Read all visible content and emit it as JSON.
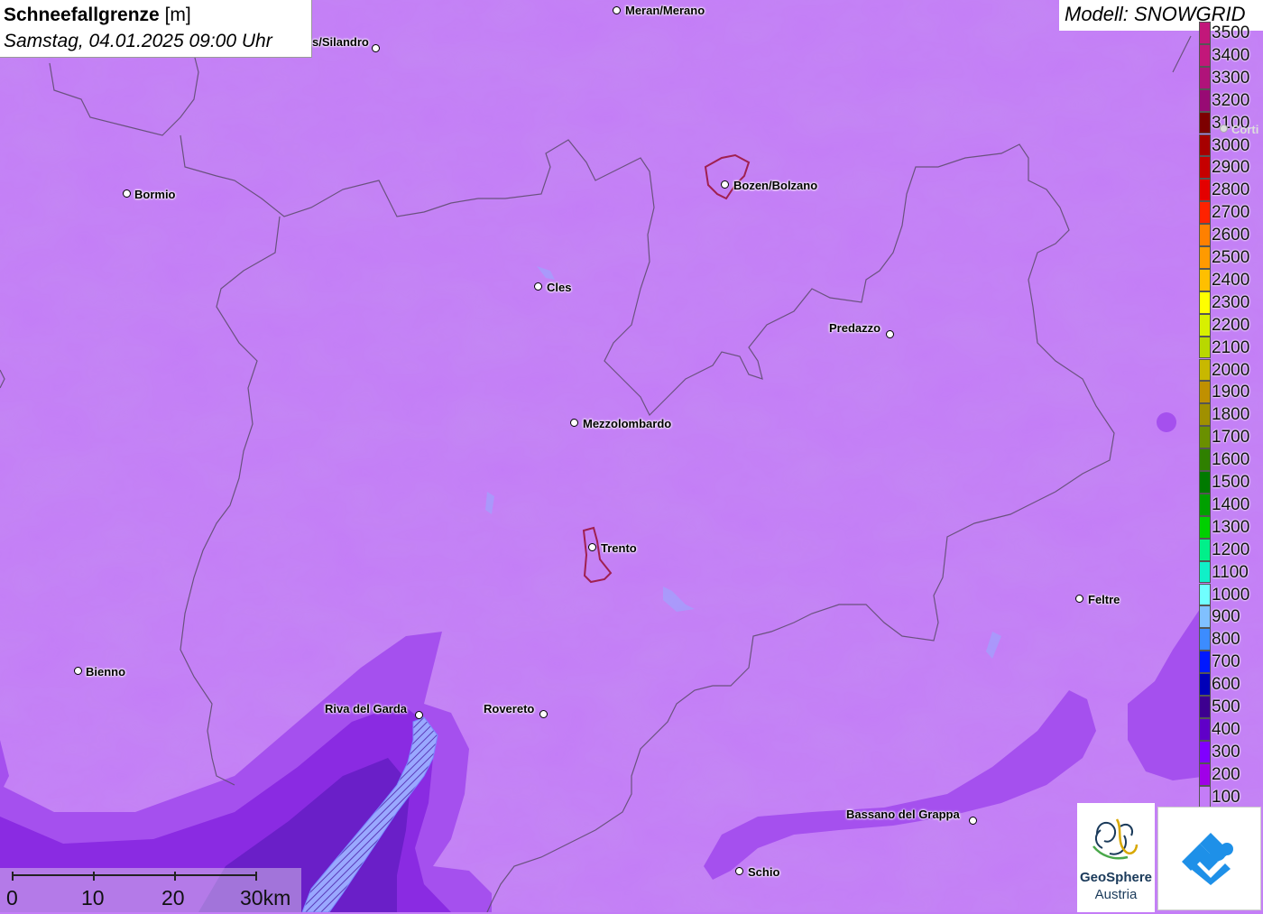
{
  "title": {
    "parameter": "Schneefallgrenze",
    "unit": "[m]",
    "datetime": "Samstag, 04.01.2025 09:00 Uhr"
  },
  "model_label": "Modell: SNOWGRID",
  "legend": {
    "items": [
      {
        "label": "3500",
        "color": "#c2177a"
      },
      {
        "label": "3400",
        "color": "#c2177a"
      },
      {
        "label": "3300",
        "color": "#b0137a"
      },
      {
        "label": "3200",
        "color": "#980a74"
      },
      {
        "label": "3100",
        "color": "#7d0000"
      },
      {
        "label": "3000",
        "color": "#a70000"
      },
      {
        "label": "2900",
        "color": "#c60000"
      },
      {
        "label": "2800",
        "color": "#e40000"
      },
      {
        "label": "2700",
        "color": "#ff2200"
      },
      {
        "label": "2600",
        "color": "#ff8000"
      },
      {
        "label": "2500",
        "color": "#ff9a00"
      },
      {
        "label": "2400",
        "color": "#ffbf00"
      },
      {
        "label": "2300",
        "color": "#ffff00"
      },
      {
        "label": "2200",
        "color": "#d8f000"
      },
      {
        "label": "2100",
        "color": "#b8d800"
      },
      {
        "label": "2000",
        "color": "#c8b800"
      },
      {
        "label": "1900",
        "color": "#c09000"
      },
      {
        "label": "1800",
        "color": "#a09000"
      },
      {
        "label": "1700",
        "color": "#6a9000"
      },
      {
        "label": "1600",
        "color": "#2f8000"
      },
      {
        "label": "1500",
        "color": "#007a00"
      },
      {
        "label": "1400",
        "color": "#00a000"
      },
      {
        "label": "1300",
        "color": "#00d000"
      },
      {
        "label": "1200",
        "color": "#00f08a"
      },
      {
        "label": "1100",
        "color": "#10f0c8"
      },
      {
        "label": "1000",
        "color": "#70ffff"
      },
      {
        "label": "900",
        "color": "#80c0ff"
      },
      {
        "label": "800",
        "color": "#3c8cff"
      },
      {
        "label": "700",
        "color": "#0018ff"
      },
      {
        "label": "600",
        "color": "#0000b8"
      },
      {
        "label": "500",
        "color": "#3d0090"
      },
      {
        "label": "400",
        "color": "#6000c8"
      },
      {
        "label": "300",
        "color": "#8000ff"
      },
      {
        "label": "200",
        "color": "#a000e8"
      },
      {
        "label": "100",
        "color": "#c47cf7"
      }
    ]
  },
  "cities": [
    {
      "name": "Meran/Merano"
    },
    {
      "name": "s/Silandro"
    },
    {
      "name": "Bormio"
    },
    {
      "name": "Bozen/Bolzano"
    },
    {
      "name": "Cles"
    },
    {
      "name": "Predazzo"
    },
    {
      "name": "Mezzolombardo"
    },
    {
      "name": "Trento"
    },
    {
      "name": "Feltre"
    },
    {
      "name": "Bienno"
    },
    {
      "name": "Riva del Garda"
    },
    {
      "name": "Rovereto"
    },
    {
      "name": "Bassano del Grappa"
    },
    {
      "name": "Schio"
    },
    {
      "name": "Corti"
    }
  ],
  "scale_bar": {
    "labels": [
      "0",
      "10",
      "20",
      "30km"
    ]
  },
  "logos": {
    "geosphere_line1": "GeoSphere",
    "geosphere_line2": "Austria"
  },
  "colors": {
    "base_fill": "#c47cf7",
    "band_200": "#a550ee",
    "band_300": "#8a2be2",
    "band_400": "#6a1fc8",
    "border_line": "#5a4a6a",
    "lake": "#9aa8ff",
    "urban_outline": "#a02050"
  }
}
